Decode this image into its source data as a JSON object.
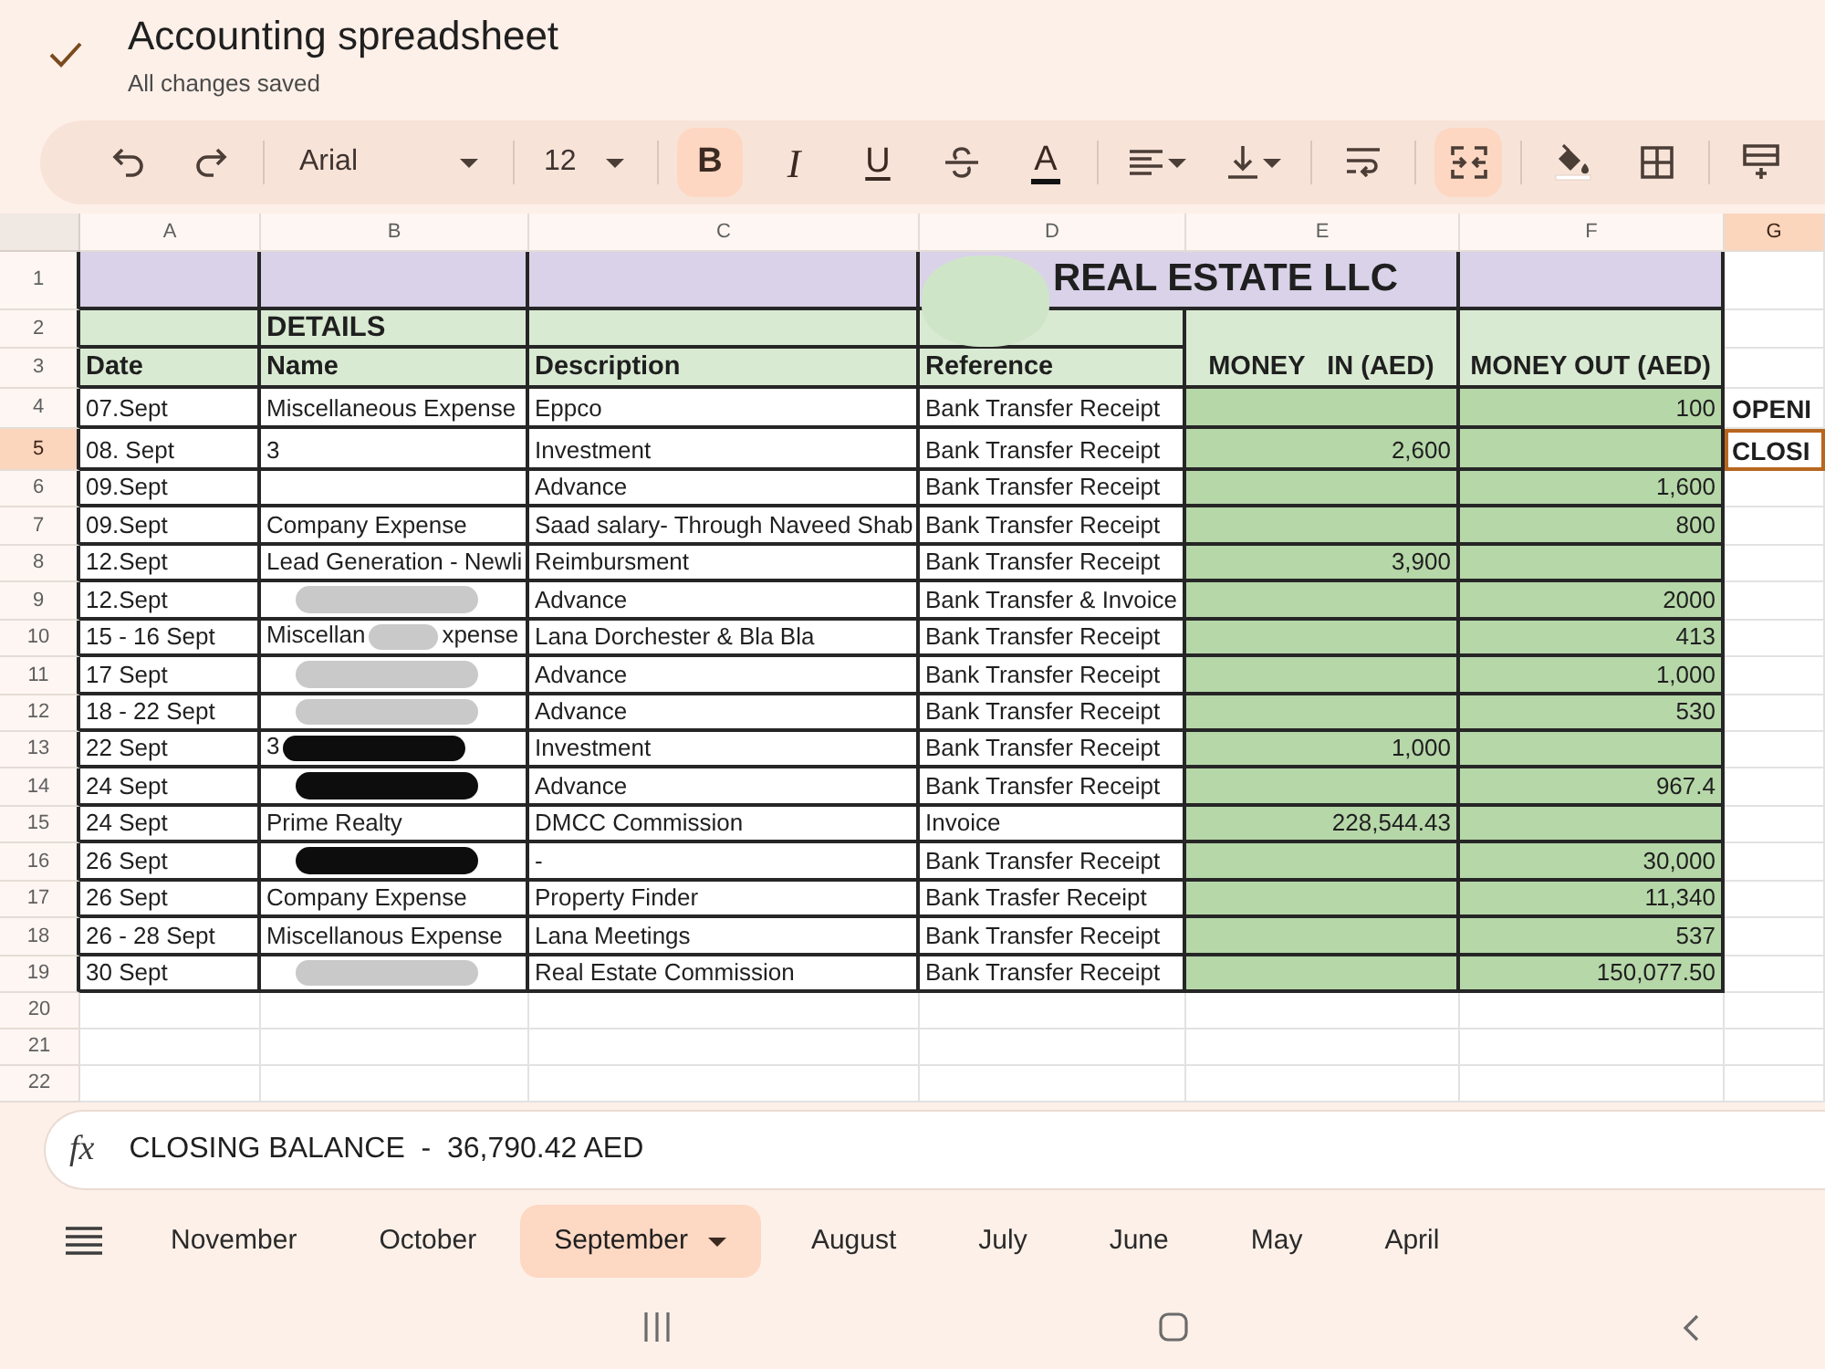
{
  "document": {
    "title": "Accounting spreadsheet",
    "status": "All changes saved"
  },
  "toolbar": {
    "groups": [
      [
        {
          "kind": "undo",
          "on": false
        },
        {
          "kind": "redo",
          "on": false
        }
      ],
      [
        {
          "kind": "font",
          "value": "Arial",
          "on": false
        }
      ],
      [
        {
          "kind": "font_size",
          "value": "12",
          "on": false
        }
      ],
      [
        {
          "kind": "bold",
          "label": "B",
          "on": true
        },
        {
          "kind": "italic",
          "label": "I",
          "on": false
        },
        {
          "kind": "underline",
          "label": "U",
          "on": false
        },
        {
          "kind": "strikethrough",
          "on": false
        },
        {
          "kind": "text_color",
          "label": "A",
          "on": false
        }
      ],
      [
        {
          "kind": "align",
          "on": false
        },
        {
          "kind": "vertical_align",
          "on": false
        }
      ],
      [
        {
          "kind": "wrap",
          "on": false
        }
      ],
      [
        {
          "kind": "merge",
          "on": true
        }
      ],
      [
        {
          "kind": "fill_color",
          "on": false
        },
        {
          "kind": "borders",
          "on": false
        }
      ],
      [
        {
          "kind": "insert",
          "on": false
        }
      ]
    ]
  },
  "sheet": {
    "columns": [
      {
        "label": "A",
        "selected": false
      },
      {
        "label": "B",
        "selected": false
      },
      {
        "label": "C",
        "selected": false
      },
      {
        "label": "D",
        "selected": false
      },
      {
        "label": "E",
        "selected": false
      },
      {
        "label": "F",
        "selected": false
      },
      {
        "label": "G",
        "selected": true
      }
    ],
    "rows": [
      {
        "number": "1",
        "selected": false,
        "kind": "banner",
        "title": "REAL ESTATE LLC",
        "redaction": {
          "color": "#cfe5c8"
        }
      },
      {
        "number": "2",
        "selected": false,
        "kind": "section",
        "label": "DETAILS",
        "money_in": "MONEY   IN (AED)",
        "money_out": "MONEY OUT (AED)"
      },
      {
        "number": "3",
        "selected": false,
        "kind": "header",
        "date": "Date",
        "name": "Name",
        "description": "Description",
        "reference": "Reference"
      },
      {
        "number": "4",
        "selected": false,
        "kind": "entry",
        "date": "07.Sept",
        "name": "Miscellaneous Expense",
        "description": "Eppco",
        "reference": "Bank Transfer Receipt",
        "money_out": "100",
        "column_g": "OPENI"
      },
      {
        "number": "5",
        "selected": true,
        "kind": "entry",
        "date": "08. Sept",
        "name": "3",
        "description": "Investment",
        "reference": "Bank Transfer Receipt",
        "money_in": "2,600",
        "column_g": "CLOSI"
      },
      {
        "number": "6",
        "selected": false,
        "kind": "entry",
        "date": "09.Sept",
        "description": "Advance",
        "reference": "Bank Transfer Receipt",
        "money_out": "1,600"
      },
      {
        "number": "7",
        "selected": false,
        "kind": "entry",
        "date": "09.Sept",
        "name": "Company Expense",
        "description": "Saad salary- Through Naveed Shab",
        "reference": "Bank Transfer Receipt",
        "money_out": "800"
      },
      {
        "number": "8",
        "selected": false,
        "kind": "entry",
        "date": "12.Sept",
        "name": "Lead Generation - Newli",
        "description": "Reimbursment",
        "reference": "Bank Transfer Receipt",
        "money_in": "3,900"
      },
      {
        "number": "9",
        "selected": false,
        "kind": "entry",
        "date": "12.Sept",
        "redaction": {
          "color": "#c9c9c9"
        },
        "description": "Advance",
        "reference": "Bank Transfer & Invoice",
        "money_out": "2000"
      },
      {
        "number": "10",
        "selected": false,
        "kind": "entry",
        "date": "15 - 16 Sept",
        "name": "Miscellan",
        "redaction": {
          "color": "#c9c9c9"
        },
        "name_tail": "xpense",
        "description": "Lana Dorchester & Bla Bla",
        "reference": "Bank Transfer Receipt",
        "money_out": "413"
      },
      {
        "number": "11",
        "selected": false,
        "kind": "entry",
        "date": "17 Sept",
        "redaction": {
          "color": "#c9c9c9"
        },
        "description": "Advance",
        "reference": "Bank Transfer Receipt",
        "money_out": "1,000"
      },
      {
        "number": "12",
        "selected": false,
        "kind": "entry",
        "date": "18 - 22 Sept",
        "redaction": {
          "color": "#c9c9c9"
        },
        "description": "Advance",
        "reference": "Bank Transfer Receipt",
        "money_out": "530"
      },
      {
        "number": "13",
        "selected": false,
        "kind": "entry",
        "date": "22 Sept",
        "name": "3",
        "redaction": {
          "color": "#0d0d0d"
        },
        "description": "Investment",
        "reference": "Bank Transfer Receipt",
        "money_in": "1,000"
      },
      {
        "number": "14",
        "selected": false,
        "kind": "entry",
        "date": "24 Sept",
        "redaction": {
          "color": "#0d0d0d"
        },
        "description": "Advance",
        "reference": "Bank Transfer Receipt",
        "money_out": "967.4"
      },
      {
        "number": "15",
        "selected": false,
        "kind": "entry",
        "date": "24 Sept",
        "name": "Prime Realty",
        "description": "DMCC Commission",
        "reference": "Invoice",
        "money_in": "228,544.43"
      },
      {
        "number": "16",
        "selected": false,
        "kind": "entry",
        "date": "26 Sept",
        "redaction": {
          "color": "#0d0d0d"
        },
        "description": "-",
        "reference": "Bank Transfer Receipt",
        "money_out": "30,000"
      },
      {
        "number": "17",
        "selected": false,
        "kind": "entry",
        "date": "26 Sept",
        "name": "Company Expense",
        "description": "Property Finder",
        "reference": "Bank Trasfer Receipt",
        "money_out": "11,340"
      },
      {
        "number": "18",
        "selected": false,
        "kind": "entry",
        "date": "26 - 28 Sept",
        "name": "Miscellanous Expense",
        "description": "Lana Meetings",
        "reference": "Bank Transfer Receipt",
        "money_out": "537"
      },
      {
        "number": "19",
        "selected": false,
        "kind": "entry",
        "date": "30 Sept",
        "redaction": {
          "color": "#c9c9c9"
        },
        "description": "Real Estate Commission",
        "reference": "Bank Transfer Receipt",
        "money_out": "150,077.50"
      },
      {
        "number": "20",
        "selected": false,
        "kind": "blank"
      },
      {
        "number": "21",
        "selected": false,
        "kind": "blank"
      },
      {
        "number": "22",
        "selected": false,
        "kind": "blank"
      }
    ]
  },
  "formula_bar": {
    "label": "fx",
    "value": "CLOSING BALANCE  -  36,790.42 AED"
  },
  "sheet_tabs": [
    {
      "label": "November",
      "selected": false
    },
    {
      "label": "October",
      "selected": false
    },
    {
      "label": "September",
      "selected": true
    },
    {
      "label": "August",
      "selected": false
    },
    {
      "label": "July",
      "selected": false
    },
    {
      "label": "June",
      "selected": false
    },
    {
      "label": "May",
      "selected": false
    },
    {
      "label": "April",
      "selected": false
    }
  ]
}
